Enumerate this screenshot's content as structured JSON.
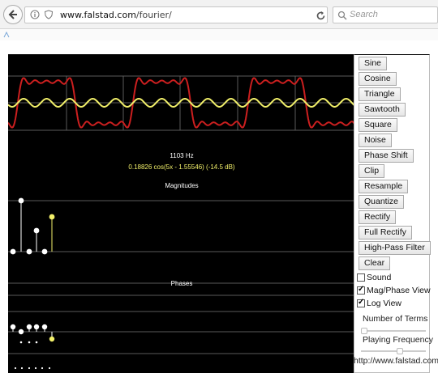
{
  "browser": {
    "url_host": "www.falstad.com",
    "url_path": "/fourier/",
    "search_placeholder": "Search"
  },
  "applet": {
    "freq_label": "1103 Hz",
    "term_label": "0.18826 cos(5x - 1.55546)   (-14.5 dB)",
    "magnitudes_label": "Magnitudes",
    "phases_label": "Phases",
    "colors": {
      "waveform": "#cc1f1f",
      "selected_term": "#f2f06a",
      "grid": "#5a5a5a",
      "dots": "#ffffff"
    }
  },
  "controls": {
    "buttons": [
      "Sine",
      "Cosine",
      "Triangle",
      "Sawtooth",
      "Square",
      "Noise",
      "Phase Shift",
      "Clip",
      "Resample",
      "Quantize",
      "Rectify",
      "Full Rectify",
      "High-Pass Filter",
      "Clear"
    ],
    "sound_label": "Sound",
    "magphase_label": "Mag/Phase View",
    "logview_label": "Log View",
    "num_terms_label": "Number of Terms",
    "playing_freq_label": "Playing Frequency",
    "footer_url": "http://www.falstad.com"
  }
}
